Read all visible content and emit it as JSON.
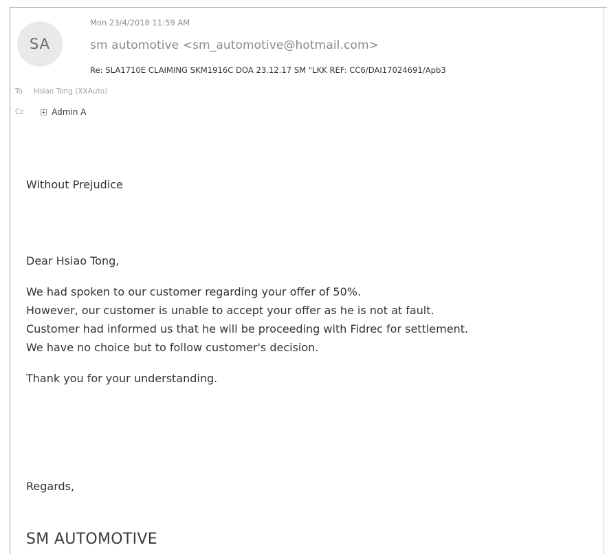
{
  "header": {
    "avatar_initials": "SA",
    "date": "Mon 23/4/2018 11:59 AM",
    "sender": "sm automotive <sm_automotive@hotmail.com>",
    "subject": "Re: SLA1710E CLAIMING SKM1916C DOA 23.12.17 SM \"LKK REF: CC6/DAI17024691/Apb3"
  },
  "recipients": {
    "to_label": "To",
    "to_value": "Hsiao Tong (XXAuto)",
    "cc_label": "Cc",
    "cc_value": "Admin A"
  },
  "body": {
    "without_prejudice": "Without Prejudice",
    "greeting": "Dear Hsiao Tong,",
    "lines": [
      "We had spoken to our customer regarding your offer of 50%.",
      "However, our customer is unable to accept your offer as he is not at fault.",
      "Customer had informed us that he will be proceeding with Fidrec for settlement.",
      "We have no choice but to follow customer's decision."
    ],
    "thanks": "Thank you for your understanding.",
    "regards": "Regards,",
    "signature": "SM AUTOMOTIVE"
  }
}
